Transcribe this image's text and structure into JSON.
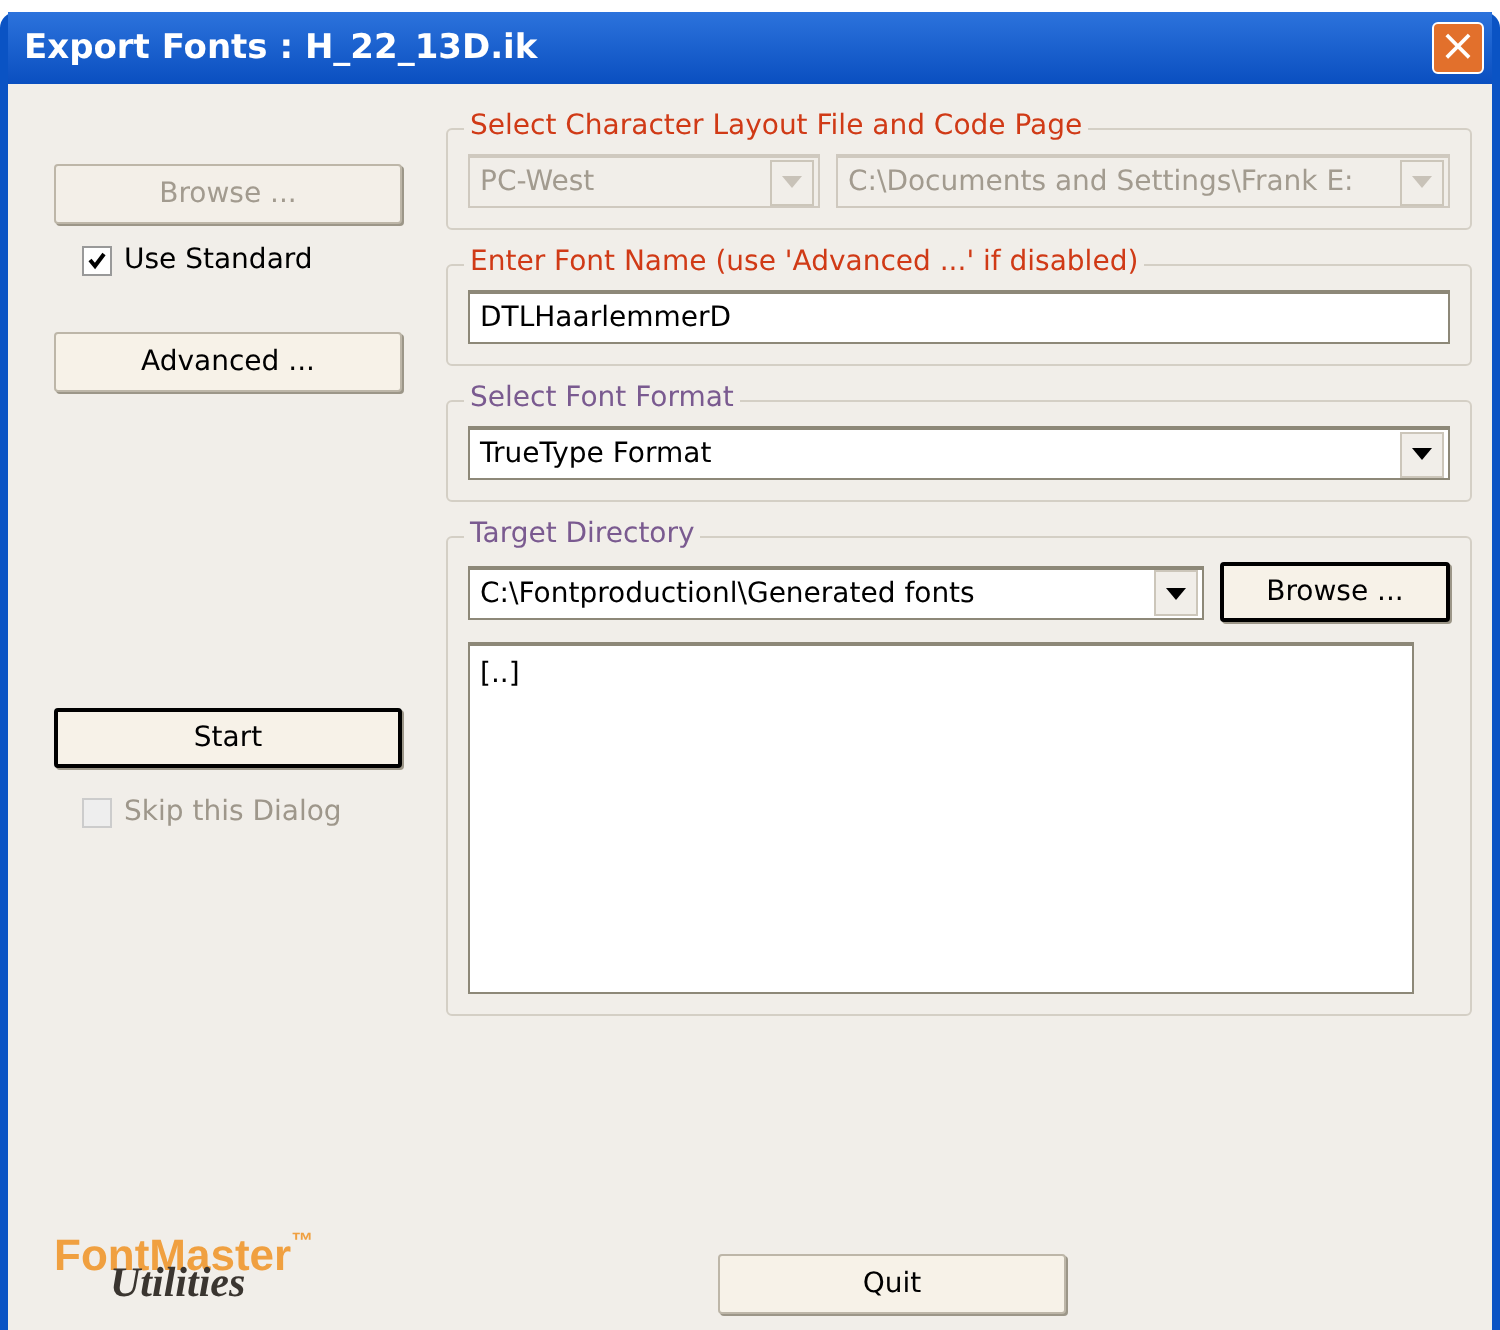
{
  "window": {
    "title": "Export Fonts : H_22_13D.ik",
    "close": "×"
  },
  "left": {
    "browse": {
      "label": "Browse ...",
      "disabled": true,
      "focused": false
    },
    "use_standard": {
      "label": "Use Standard",
      "checked": true,
      "disabled": false
    },
    "advanced": {
      "label": "Advanced ...",
      "disabled": false,
      "focused": false
    },
    "start": {
      "label": "Start",
      "disabled": false,
      "focused": true
    },
    "skip": {
      "label": "Skip this Dialog",
      "checked": false,
      "disabled": true
    }
  },
  "groups": [
    {
      "kind": "layout",
      "title": "Select Character Layout File and Code Page",
      "highlighted": true,
      "code_page": {
        "value": "PC-West",
        "disabled": true
      },
      "layout_file": {
        "value": "C:\\Documents and Settings\\Frank E:",
        "disabled": true
      }
    },
    {
      "kind": "name",
      "title": "Enter Font Name (use 'Advanced ...' if disabled)",
      "highlighted": true,
      "field": {
        "value": "DTLHaarlemmerD",
        "disabled": false
      }
    },
    {
      "kind": "format",
      "title": "Select Font Format",
      "highlighted": false,
      "field": {
        "value": "TrueType Format",
        "disabled": false
      }
    },
    {
      "kind": "target",
      "title": "Target Directory",
      "highlighted": false,
      "field": {
        "value": "C:\\Fontproductionl\\Generated fonts",
        "disabled": false
      },
      "browse": {
        "label": "Browse ...",
        "disabled": false,
        "focused": true
      },
      "list": [
        "[..]"
      ]
    }
  ],
  "logo": {
    "name": "FontMaster",
    "mark": "™",
    "subtitle": "Utilities"
  },
  "quit": {
    "label": "Quit",
    "disabled": false,
    "focused": false
  }
}
